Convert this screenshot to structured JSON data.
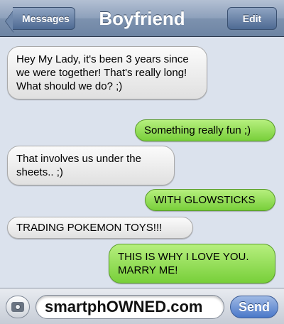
{
  "header": {
    "back_label": "Messages",
    "title": "Boyfriend",
    "edit_label": "Edit"
  },
  "messages": [
    {
      "sender": "received",
      "text": "Hey My Lady, it's been 3 years since we were together! That's really long! What should we do? ;)"
    },
    {
      "sender": "sent",
      "text": "Something really fun ;)"
    },
    {
      "sender": "received",
      "text": "That involves us under the sheets.. ;)"
    },
    {
      "sender": "sent",
      "text": "WITH GLOWSTICKS"
    },
    {
      "sender": "received",
      "text": "TRADING POKEMON TOYS!!!"
    },
    {
      "sender": "sent",
      "text": "THIS IS WHY I LOVE YOU. MARRY ME!"
    }
  ],
  "input": {
    "camera_icon": "camera-icon",
    "value": "smartphOWNED.com",
    "send_label": "Send"
  },
  "colors": {
    "background": "#dbe2ed",
    "sent_bubble": "#8bdc4c",
    "received_bubble": "#eeeeee",
    "navbar": "#7d92af",
    "send_button": "#4a78c9"
  }
}
